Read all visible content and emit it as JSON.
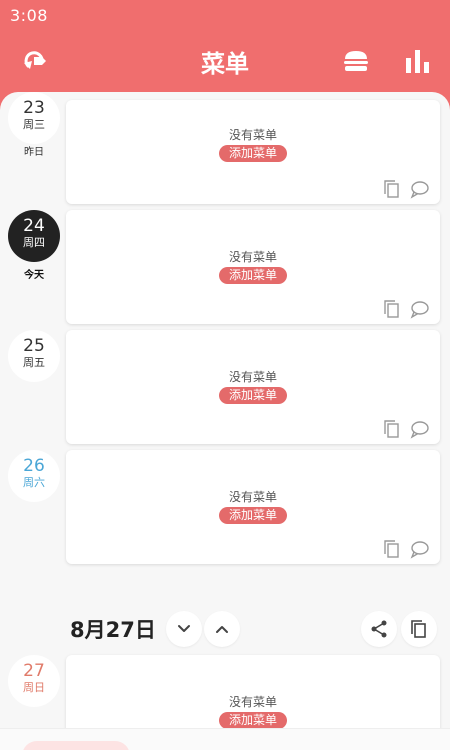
{
  "status_bar": {
    "time": "3:08"
  },
  "toolbar": {
    "title": "菜单",
    "icons": [
      "refresh-tag-icon",
      "burger-icon",
      "bar-chart-icon"
    ]
  },
  "colors": {
    "header": "#f06e6e",
    "accent": "#e46a6a",
    "saturday": "#4aa6d6",
    "sunday": "#e07b6a"
  },
  "days": [
    {
      "num": "23",
      "weekday": "周三",
      "label": "昨日",
      "empty_text": "没有菜单",
      "add_label": "添加菜单"
    },
    {
      "num": "24",
      "weekday": "周四",
      "label": "今天",
      "empty_text": "没有菜单",
      "add_label": "添加菜单"
    },
    {
      "num": "25",
      "weekday": "周五",
      "empty_text": "没有菜单",
      "add_label": "添加菜单"
    },
    {
      "num": "26",
      "weekday": "周六",
      "empty_text": "没有菜单",
      "add_label": "添加菜单"
    }
  ],
  "next_section": {
    "date_title": "8月27日",
    "day": {
      "num": "27",
      "weekday": "周日",
      "empty_text": "没有菜单",
      "add_label": "添加菜单"
    }
  }
}
